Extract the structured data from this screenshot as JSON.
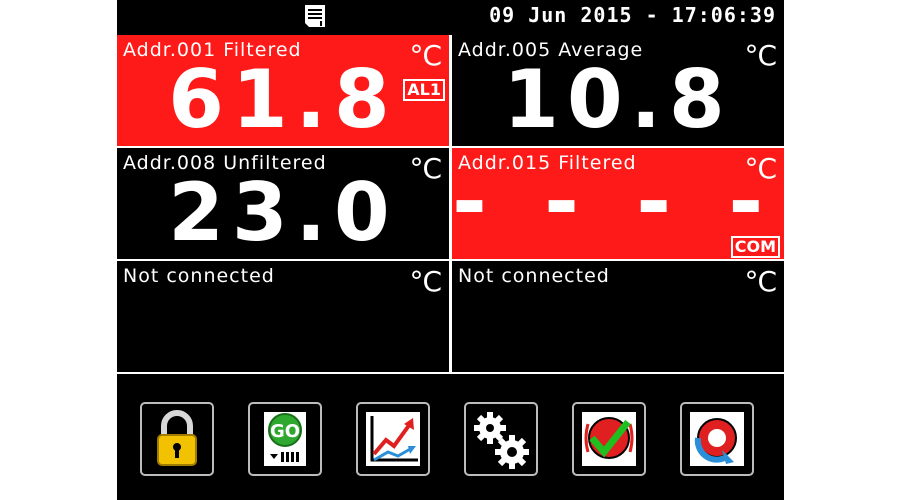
{
  "header": {
    "datetime": "09 Jun 2015 - 17:06:39",
    "icon": "sd-card-icon"
  },
  "channels": [
    {
      "label": "Addr.001 Filtered",
      "unit": "°C",
      "value": "61.8",
      "flag": "AL1",
      "state": "alarm"
    },
    {
      "label": "Addr.005 Average",
      "unit": "°C",
      "value": "10.8",
      "flag": "",
      "state": "normal"
    },
    {
      "label": "Addr.008 Unfiltered",
      "unit": "°C",
      "value": "23.0",
      "flag": "",
      "state": "normal"
    },
    {
      "label": "Addr.015 Filtered",
      "unit": "°C",
      "value": "- - - - -",
      "flag": "COM",
      "state": "alarm"
    },
    {
      "label": "Not connected",
      "unit": "°C",
      "value": "",
      "flag": "",
      "state": "normal"
    },
    {
      "label": "Not connected",
      "unit": "°C",
      "value": "",
      "flag": "",
      "state": "normal"
    }
  ],
  "toolbar": {
    "buttons": [
      {
        "icon": "padlock-icon"
      },
      {
        "icon": "go-record-icon",
        "text": "GO"
      },
      {
        "icon": "trend-chart-icon"
      },
      {
        "icon": "settings-gears-icon"
      },
      {
        "icon": "alarm-acknowledge-icon"
      },
      {
        "icon": "reset-icon"
      }
    ]
  },
  "colors": {
    "alarm_tile": "#ff1a1a",
    "normal_tile": "#000000",
    "text": "#ffffff",
    "button_border": "#bcbcbc"
  }
}
